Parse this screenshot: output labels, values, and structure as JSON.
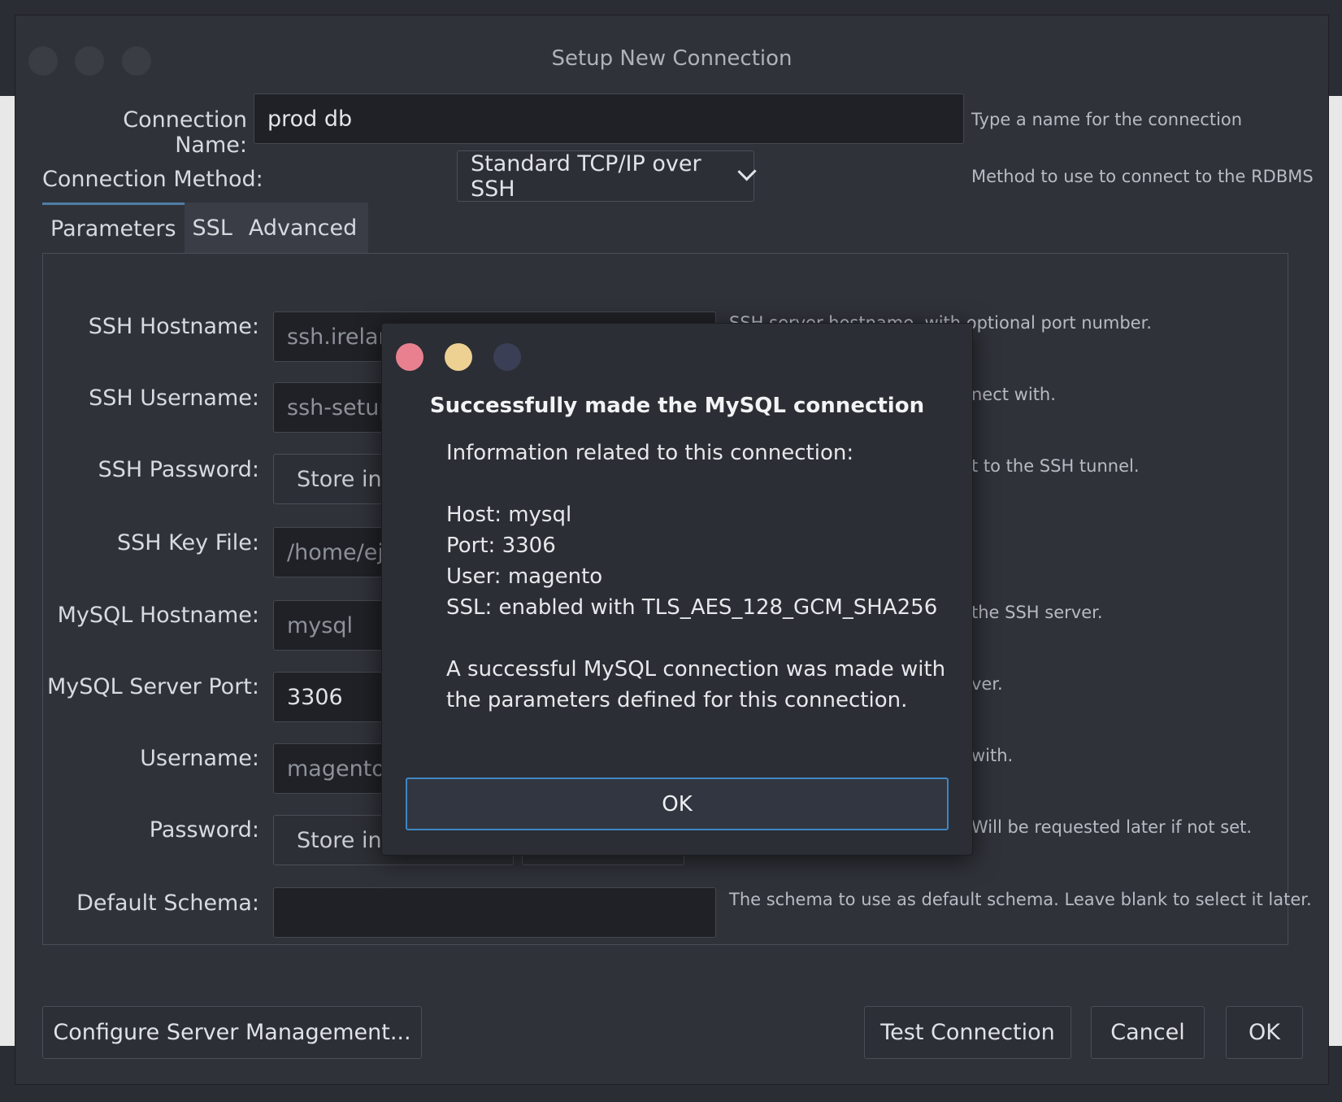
{
  "dialog": {
    "title": "Setup New Connection",
    "connection_name_label": "Connection Name:",
    "connection_name_value": "prod db",
    "connection_name_hint": "Type a name for the connection",
    "connection_method_label": "Connection Method:",
    "connection_method_value": "Standard TCP/IP over SSH",
    "connection_method_hint": "Method to use to connect to the RDBMS",
    "tabs": [
      "Parameters",
      "SSL",
      "Advanced"
    ]
  },
  "params": {
    "ssh_hostname_label": "SSH Hostname:",
    "ssh_hostname_value": "ssh.irelan",
    "ssh_hostname_hint": "SSH server hostname, with  optional port number.",
    "ssh_username_label": "SSH Username:",
    "ssh_username_value": "ssh-setup",
    "ssh_username_hint": "nect with.",
    "ssh_password_label": "SSH Password:",
    "ssh_password_button": "Store in",
    "ssh_password_hint": "t to the SSH tunnel.",
    "ssh_keyfile_label": "SSH Key File:",
    "ssh_keyfile_value": "/home/ej",
    "mysql_hostname_label": "MySQL Hostname:",
    "mysql_hostname_value": "mysql",
    "mysql_hostname_hint": "the SSH server.",
    "mysql_port_label": "MySQL Server Port:",
    "mysql_port_value": "3306",
    "mysql_port_hint": "ver.",
    "username_label": "Username:",
    "username_value": "magento",
    "username_hint": "with.",
    "password_label": "Password:",
    "password_button": "Store in",
    "password_hint": "Will be requested later if not set.",
    "schema_label": "Default Schema:",
    "schema_value": "",
    "schema_hint": "The schema to use as default schema. Leave blank to select it later."
  },
  "footer": {
    "configure_label": "Configure Server Management...",
    "test_label": "Test Connection",
    "cancel_label": "Cancel",
    "ok_label": "OK"
  },
  "modal": {
    "title": "Successfully made the MySQL connection",
    "intro": "Information related to this connection:",
    "host": "Host: mysql",
    "port": "Port: 3306",
    "user": "User: magento",
    "ssl": "SSL: enabled with TLS_AES_128_GCM_SHA256",
    "message_line1": "A successful MySQL connection was made with",
    "message_line2": "the parameters defined for this connection.",
    "ok_label": "OK"
  },
  "colors": {
    "accent": "#3f86c4",
    "close_dot": "#e8808f",
    "minimize_dot": "#ecd193",
    "maximize_dot": "#3b3f55"
  }
}
